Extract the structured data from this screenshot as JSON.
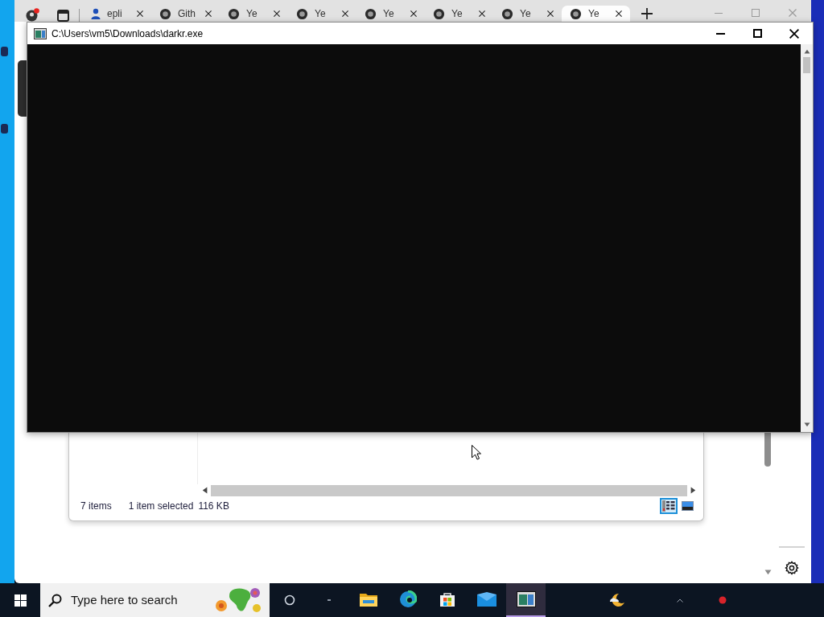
{
  "browser": {
    "tabs": [
      {
        "kind": "person",
        "label": "epli",
        "selected": false
      },
      {
        "kind": "circle",
        "label": "Gith",
        "selected": false
      },
      {
        "kind": "circle",
        "label": "Ye",
        "selected": false
      },
      {
        "kind": "circle",
        "label": "Ye",
        "selected": false
      },
      {
        "kind": "circle",
        "label": "Ye",
        "selected": false
      },
      {
        "kind": "circle",
        "label": "Ye",
        "selected": false
      },
      {
        "kind": "circle",
        "label": "Ye",
        "selected": false
      },
      {
        "kind": "circle",
        "label": "Ye",
        "selected": true
      }
    ]
  },
  "console_window": {
    "title": "C:\\Users\\vm5\\Downloads\\darkr.exe"
  },
  "explorer": {
    "status_bar": {
      "item_count": "7 items",
      "selection": "1 item selected",
      "size": "116 KB"
    },
    "views": [
      {
        "kind": "details",
        "selected": true
      },
      {
        "kind": "large-icons",
        "selected": false
      }
    ]
  },
  "taskbar": {
    "search": {
      "placeholder": "Type here to search"
    },
    "apps": [
      {
        "kind": "file-explorer",
        "active": false
      },
      {
        "kind": "edge",
        "active": false
      },
      {
        "kind": "store",
        "active": false
      },
      {
        "kind": "mail",
        "active": false
      },
      {
        "kind": "console",
        "active": true
      }
    ]
  }
}
